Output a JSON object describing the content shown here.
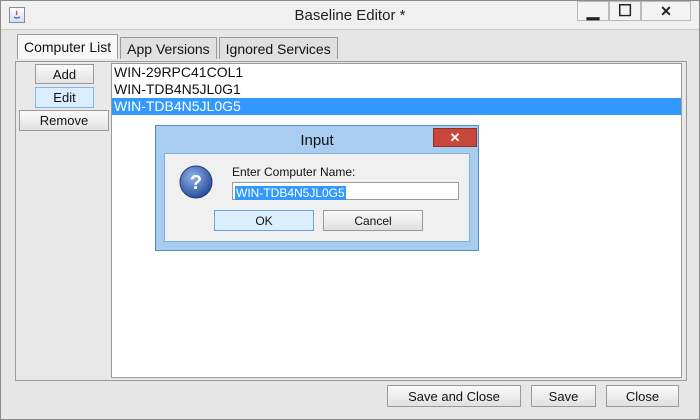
{
  "window": {
    "title": "Baseline Editor *",
    "minimize_glyph": "▁",
    "maximize_glyph": "☐",
    "close_glyph": "✕"
  },
  "tabs": [
    {
      "label": "Computer List",
      "active": true
    },
    {
      "label": "App Versions",
      "active": false
    },
    {
      "label": "Ignored Services",
      "active": false
    }
  ],
  "side_buttons": {
    "add": "Add",
    "edit": "Edit",
    "remove": "Remove"
  },
  "computer_list": [
    {
      "name": "WIN-29RPC41COL1",
      "selected": false
    },
    {
      "name": "WIN-TDB4N5JL0G1",
      "selected": false
    },
    {
      "name": "WIN-TDB4N5JL0G5",
      "selected": true
    }
  ],
  "dialog": {
    "title": "Input",
    "close_glyph": "✕",
    "prompt": "Enter Computer Name:",
    "value": "WIN-TDB4N5JL0G5",
    "ok": "OK",
    "cancel": "Cancel",
    "icon": "question-icon"
  },
  "bottom_buttons": {
    "save_and_close": "Save and Close",
    "save": "Save",
    "close": "Close"
  },
  "colors": {
    "selection": "#3399ff",
    "dialog_frame": "#a8cdf0",
    "close_red": "#c8473b"
  }
}
